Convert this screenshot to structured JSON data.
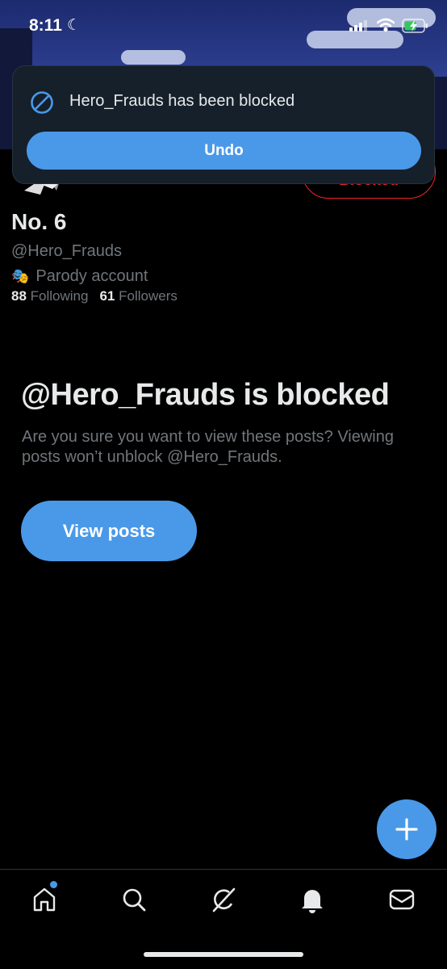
{
  "status_bar": {
    "time": "8:11",
    "moon_icon": "moon-icon",
    "battery_icon": "battery-charging-icon"
  },
  "toast": {
    "icon": "block-icon",
    "message": "Hero_Frauds has been blocked",
    "undo_label": "Undo"
  },
  "profile": {
    "blocked_button_label": "Blocked",
    "display_name": "No. 6",
    "handle": "@Hero_Frauds",
    "parody_label": "Parody account",
    "following_count": "88",
    "following_label": "Following",
    "followers_count": "61",
    "followers_label": "Followers"
  },
  "blocked_notice": {
    "title": "@Hero_Frauds is blocked",
    "body": "Are you sure you want to view these posts? Viewing posts won’t unblock @Hero_Frauds.",
    "view_posts_label": "View posts"
  },
  "tab_bar": {
    "items": [
      {
        "icon": "home-icon"
      },
      {
        "icon": "search-icon"
      },
      {
        "icon": "grok-icon"
      },
      {
        "icon": "notifications-icon"
      },
      {
        "icon": "messages-icon"
      }
    ]
  },
  "colors": {
    "accent": "#4a99e9",
    "blocked_red": "#f4212e",
    "muted": "#71767b",
    "background": "#000000"
  }
}
